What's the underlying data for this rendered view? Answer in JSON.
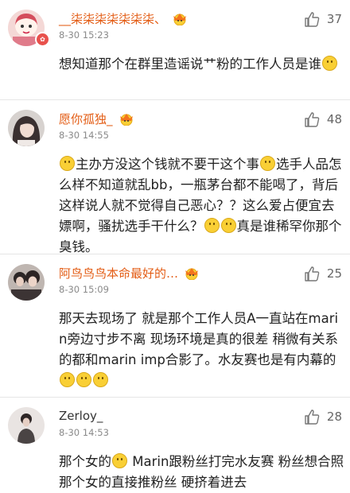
{
  "comments": [
    {
      "name": "__柒柒柒柒柒柒柒、",
      "time": "8-30 15:23",
      "likes": "37",
      "text": [
        "想知道那个在群里造谣说艹粉的工作人员是谁",
        "[emoji]"
      ],
      "vip": true,
      "name_colored": true
    },
    {
      "name": "愿你孤独_",
      "time": "8-30 14:55",
      "likes": "48",
      "text": [
        "[emoji]",
        "主办方没这个钱就不要干这个事",
        "[emoji]",
        "选手人品怎么样不知道就乱bb，一瓶茅台都不能喝了，背后这样说人就不觉得自己恶心？？这么爱占便宜去嫖啊，骚扰选手干什么？",
        "[emoji]",
        "[emoji]",
        "真是谁稀罕你那个臭钱。"
      ],
      "vip": false,
      "name_colored": true
    },
    {
      "name": "阿鸟鸟鸟本命最好的…",
      "time": "8-30 15:09",
      "likes": "25",
      "text": [
        "那天去现场了 就是那个工作人员A一直站在marin旁边寸步不离 现场环境是真的很差 稍微有关系的都和marin imp合影了。水友赛也是有内幕的",
        "[emoji]",
        "[emoji]",
        "[emoji]"
      ],
      "vip": false,
      "name_colored": true
    },
    {
      "name": "Zerloy_",
      "time": "8-30 14:53",
      "likes": "28",
      "text": [
        "那个女的",
        "[emoji]",
        " Marin跟粉丝打完水友赛 粉丝想合照 那个女的直接推粉丝 硬挤着进去"
      ],
      "vip": false,
      "name_colored": false
    }
  ],
  "colors": {
    "name": "#e35c14",
    "time": "#8a8a8a",
    "badge": "#e8514c",
    "divider": "#e6e6e6"
  },
  "icons": {
    "like": "thumb-up-icon",
    "member": "crown-icon",
    "emoji": "smile-emoji-icon",
    "vip": "vip-badge-icon"
  }
}
